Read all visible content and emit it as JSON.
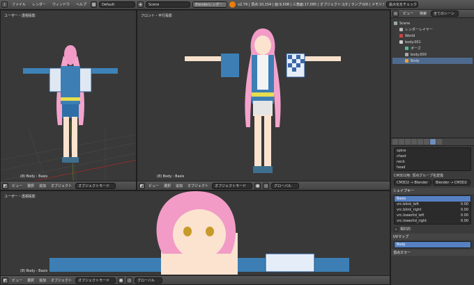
{
  "topbar": {
    "menus": [
      "ファイル",
      "レンダー",
      "ウィンドウ",
      "ヘルプ"
    ],
    "screen_layout": "Default",
    "scene": "Scene",
    "render_engine": "Blenderレンダー",
    "stats": "v2.79 | 頂点:10,154 | 面:9,508 | 三角面:17,585 | オブジェクト:1/3 | ランプ:0/0 | メモリ:56.58M | Body",
    "feature_button": "拡大化をチェック"
  },
  "viewports": {
    "top_left_title": "ユーザー・透視投影",
    "top_right_title": "フロント・平行投影",
    "bottom_title": "ユーザー・透視投影",
    "status": "(8) Body : Basis",
    "header_menus": [
      "ビュー",
      "選択",
      "追加",
      "オブジェクト"
    ],
    "mode": "オブジェクトモード",
    "orientation": "グローバル"
  },
  "outliner": {
    "header_menus": [
      "ビュー",
      "検索",
      "全てのシーン"
    ],
    "items": [
      {
        "label": "Scene",
        "depth": 0
      },
      {
        "label": "レンダーレイヤー",
        "depth": 1
      },
      {
        "label": "World",
        "depth": 1
      },
      {
        "label": "body.001",
        "depth": 1
      },
      {
        "label": "ポーズ",
        "depth": 2
      },
      {
        "label": "body.000",
        "depth": 2
      },
      {
        "label": "Body",
        "depth": 2
      }
    ]
  },
  "properties": {
    "bones": [
      "spine",
      "chest",
      "neck",
      "head"
    ],
    "vertex_group_hint": "CM3D2用: 頂点グループ名変換",
    "convert_left": "CM3D2 → Blender",
    "convert_right": "Blender → CM3D2",
    "shape_keys_title": "シェイプキー",
    "shape_keys": [
      {
        "name": "Basis",
        "value": ""
      },
      {
        "name": "vrc.blink_left",
        "value": "0.00"
      },
      {
        "name": "vrc.blink_right",
        "value": "0.00"
      },
      {
        "name": "vrc.lowerlid_left",
        "value": "0.00"
      },
      {
        "name": "vrc.lowerlid_right",
        "value": "0.00"
      }
    ],
    "relative_label": "相対的",
    "uv_title": "UVマップ",
    "uv_items": [
      "Body"
    ],
    "vertex_colors_title": "頂点カラー"
  }
}
